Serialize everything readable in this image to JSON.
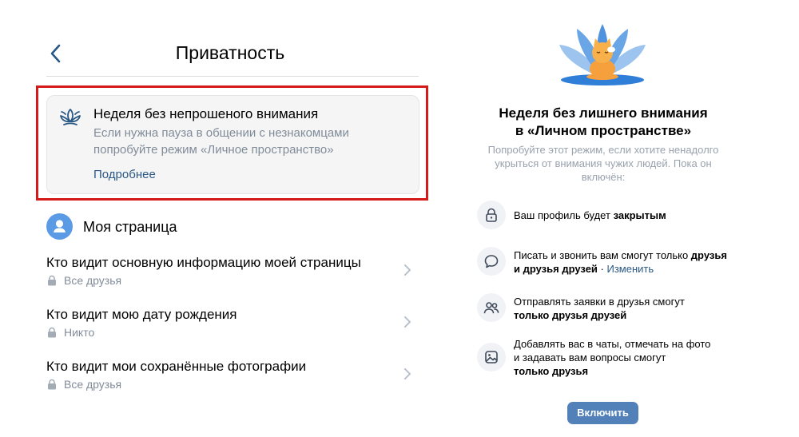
{
  "header": {
    "title": "Приватность",
    "back_icon": "chevron-left-icon"
  },
  "banner": {
    "icon": "lotus-icon",
    "title": "Неделя без непрошеного внимания",
    "text_line1": "Если нужна пауза в общении с незнакомцами",
    "text_line2": "попробуйте режим «Личное пространство»",
    "link": "Подробнее"
  },
  "my_page": {
    "title": "Моя страница",
    "items": [
      {
        "title": "Кто видит основную информацию моей страницы",
        "value": "Все друзья"
      },
      {
        "title": "Кто видит мою дату рождения",
        "value": "Никто"
      },
      {
        "title": "Кто видит мои сохранённые фотографии",
        "value": "Все друзья"
      }
    ]
  },
  "promo": {
    "title_line1": "Неделя без лишнего внимания",
    "title_line2": "в «Личном пространстве»",
    "subtitle_line1": "Попробуйте этот режим, если хотите ненадолго",
    "subtitle_line2": "укрыться от внимания чужих людей. Пока он",
    "subtitle_line3": "включён:",
    "features": [
      {
        "icon": "lock-icon",
        "text": "Ваш профиль будет ",
        "bold": "закрытым"
      },
      {
        "icon": "chat-bubble-icon",
        "line1_text": "Писать и звонить вам смогут только ",
        "line1_bold": "друзья",
        "line2_bold": "и друзья друзей",
        "line2_sep": " · ",
        "link": "Изменить"
      },
      {
        "icon": "users-icon",
        "line1_text": "Отправлять заявки в друзья смогут",
        "line2_bold": "только друзья друзей"
      },
      {
        "icon": "photo-icon",
        "line1_text": "Добавлять вас в чаты, отмечать на фото",
        "line2_text": "и задавать вам вопросы смогут",
        "line3_bold": "только друзья"
      }
    ],
    "button": "Включить"
  },
  "colors": {
    "accent": "#2a5885",
    "button": "#5181b8",
    "highlight_border": "#d61a1a",
    "secondary_text": "#818c99"
  }
}
